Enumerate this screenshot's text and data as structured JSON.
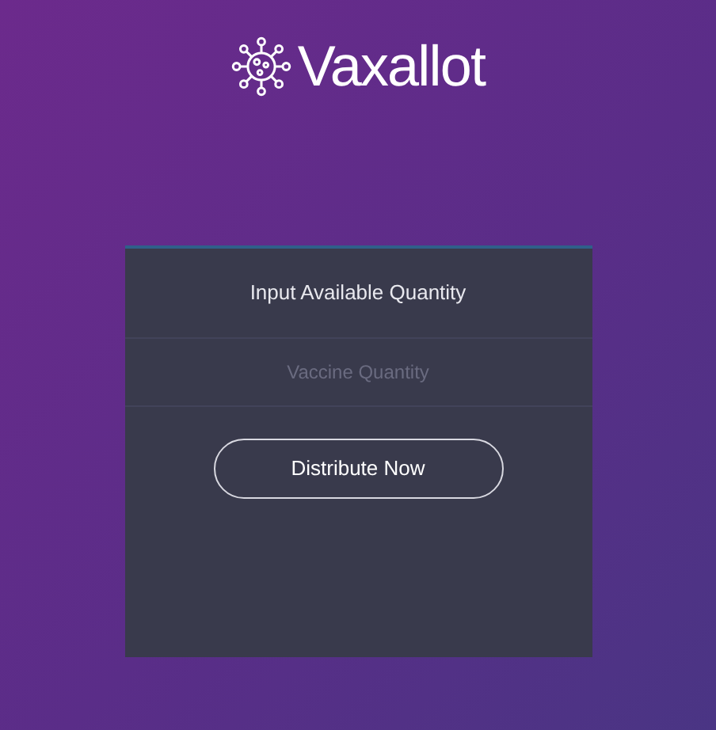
{
  "logo": {
    "text": "Vaxallot"
  },
  "card": {
    "title": "Input Available Quantity",
    "quantity_field": {
      "placeholder": "Vaccine Quantity"
    },
    "button": "Distribute Now"
  }
}
